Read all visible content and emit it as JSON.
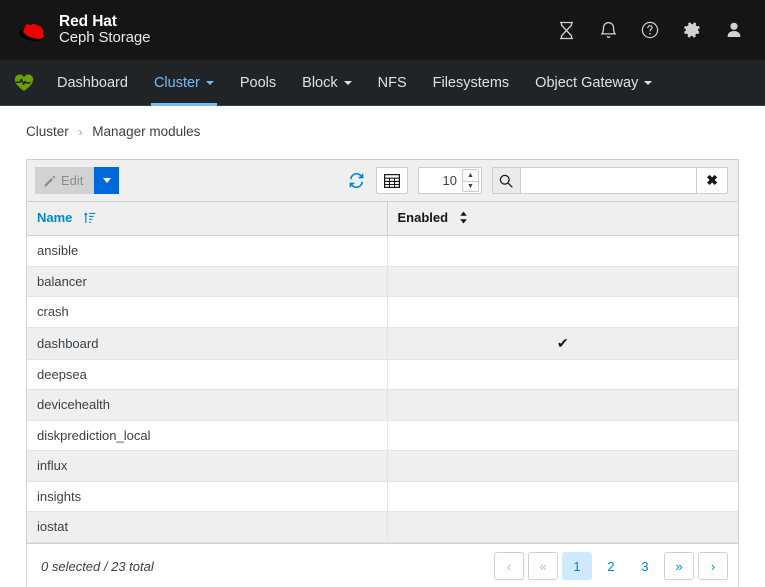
{
  "masthead": {
    "brand_line1": "Red Hat",
    "brand_line2": "Ceph Storage",
    "logo_icon": "redhat-fedora-icon",
    "icons": [
      {
        "name": "tasks-hourglass-icon",
        "label": "Tasks"
      },
      {
        "name": "bell-icon",
        "label": "Notifications"
      },
      {
        "name": "help-circle-icon",
        "label": "Help"
      },
      {
        "name": "gear-icon",
        "label": "Settings"
      },
      {
        "name": "user-icon",
        "label": "User"
      }
    ]
  },
  "navbar": {
    "health_icon": "heart-pulse-icon",
    "items": [
      {
        "label": "Dashboard",
        "active": false,
        "caret": false
      },
      {
        "label": "Cluster",
        "active": true,
        "caret": true
      },
      {
        "label": "Pools",
        "active": false,
        "caret": false
      },
      {
        "label": "Block",
        "active": false,
        "caret": true
      },
      {
        "label": "NFS",
        "active": false,
        "caret": false
      },
      {
        "label": "Filesystems",
        "active": false,
        "caret": false
      },
      {
        "label": "Object Gateway",
        "active": false,
        "caret": true
      }
    ]
  },
  "breadcrumb": {
    "root": "Cluster",
    "separator": "›",
    "current": "Manager modules"
  },
  "toolbar": {
    "edit_label": "Edit",
    "edit_icon": "pencil-icon",
    "dropdown_icon": "caret-down-icon",
    "refresh_icon": "refresh-icon",
    "grid_icon": "table-columns-icon",
    "page_limit": "10",
    "spinner_up": "▲",
    "spinner_down": "▼",
    "search_icon": "search-icon",
    "search_value": "",
    "search_placeholder": "",
    "clear_icon": "close-x-icon",
    "clear_glyph": "✖"
  },
  "table": {
    "columns": [
      {
        "label": "Name",
        "sort": "ascending",
        "sort_icon": "sort-amount-asc-icon"
      },
      {
        "label": "Enabled",
        "sort": "none",
        "sort_icon": "sort-updown-icon"
      }
    ],
    "check_glyph": "✔",
    "rows": [
      {
        "name": "ansible",
        "enabled": false
      },
      {
        "name": "balancer",
        "enabled": false
      },
      {
        "name": "crash",
        "enabled": false
      },
      {
        "name": "dashboard",
        "enabled": true
      },
      {
        "name": "deepsea",
        "enabled": false
      },
      {
        "name": "devicehealth",
        "enabled": false
      },
      {
        "name": "diskprediction_local",
        "enabled": false
      },
      {
        "name": "influx",
        "enabled": false
      },
      {
        "name": "insights",
        "enabled": false
      },
      {
        "name": "iostat",
        "enabled": false
      }
    ]
  },
  "footer": {
    "status": "0 selected / 23 total",
    "pagination": [
      {
        "label": "‹",
        "name": "pagination-prev",
        "state": "disabled",
        "boxed": true
      },
      {
        "label": "«",
        "name": "pagination-first",
        "state": "disabled",
        "boxed": true
      },
      {
        "label": "1",
        "name": "pagination-page-1",
        "state": "active",
        "boxed": true
      },
      {
        "label": "2",
        "name": "pagination-page-2",
        "state": "link",
        "boxed": false
      },
      {
        "label": "3",
        "name": "pagination-page-3",
        "state": "link",
        "boxed": false
      },
      {
        "label": "»",
        "name": "pagination-last",
        "state": "link",
        "boxed": true
      },
      {
        "label": "›",
        "name": "pagination-next",
        "state": "link",
        "boxed": true
      }
    ]
  },
  "colors": {
    "masthead_bg": "#151515",
    "navbar_bg": "#212427",
    "accent_blue": "#0088ce",
    "active_nav": "#73bcf7",
    "brand_red": "#ee0000",
    "health_green": "#6ca100",
    "row_stripe": "#efefef"
  }
}
